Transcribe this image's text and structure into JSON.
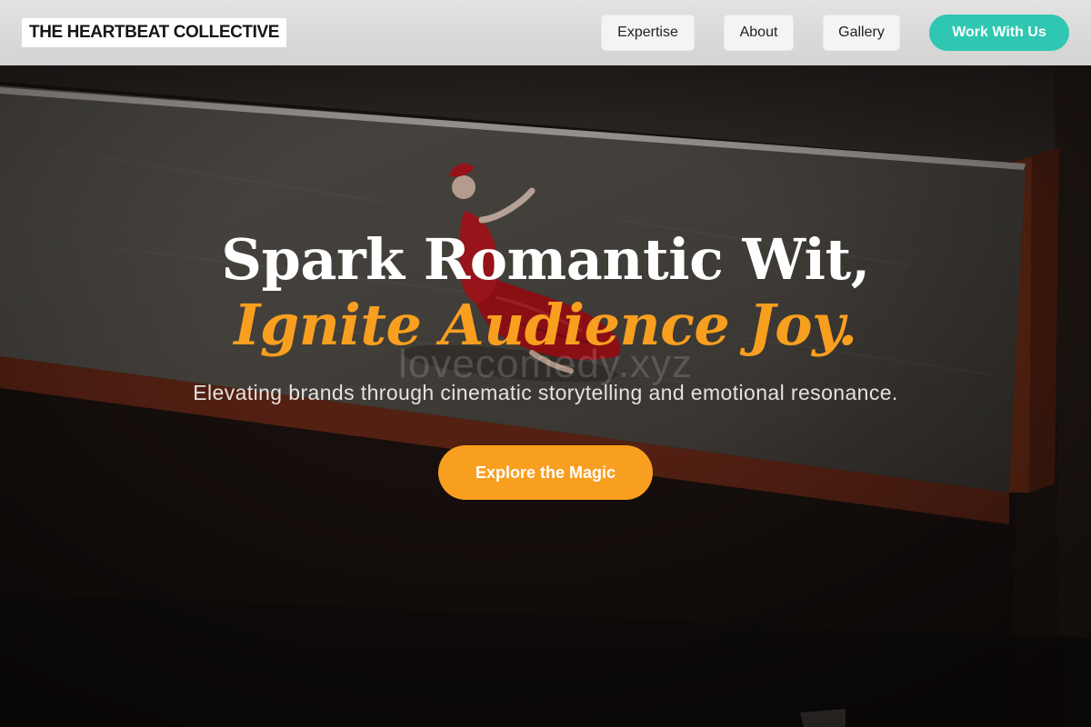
{
  "header": {
    "logo_text": "THE HEARTBEAT COLLECTIVE",
    "nav": {
      "expertise": "Expertise",
      "about": "About",
      "gallery": "Gallery"
    },
    "cta_label": "Work With Us"
  },
  "hero": {
    "headline_line1": "Spark Romantic Wit,",
    "headline_line2": "Ignite Audience Joy.",
    "watermark_text": "lovecomedy.xyz",
    "subtitle": "Elevating brands through cinematic storytelling and emotional resonance.",
    "cta_label": "Explore the Magic"
  },
  "colors": {
    "accent_orange": "#f99f1f",
    "accent_teal": "#2fc7b2",
    "header_bg": "#d8d8d8",
    "hero_dark": "#1a1411"
  }
}
